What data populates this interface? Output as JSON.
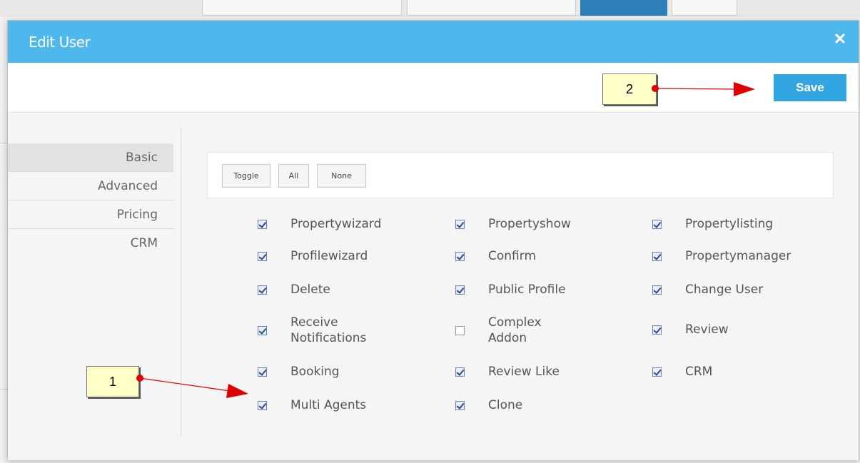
{
  "modal": {
    "title": "Edit User",
    "close_label": "✕",
    "save_label": "Save"
  },
  "sidenav": {
    "items": [
      {
        "label": "Basic",
        "active": true
      },
      {
        "label": "Advanced",
        "active": false
      },
      {
        "label": "Pricing",
        "active": false
      },
      {
        "label": "CRM",
        "active": false
      }
    ]
  },
  "toggle_buttons": {
    "toggle": "Toggle",
    "all": "All",
    "none": "None"
  },
  "permissions": [
    {
      "label": "Propertywizard",
      "checked": true
    },
    {
      "label": "Propertyshow",
      "checked": true
    },
    {
      "label": "Propertylisting",
      "checked": true
    },
    {
      "label": "Profilewizard",
      "checked": true
    },
    {
      "label": "Confirm",
      "checked": true
    },
    {
      "label": "Propertymanager",
      "checked": true
    },
    {
      "label": "Delete",
      "checked": true
    },
    {
      "label": "Public Profile",
      "checked": true
    },
    {
      "label": "Change User",
      "checked": true
    },
    {
      "label": "Receive Notifications",
      "checked": true
    },
    {
      "label": "Complex Addon",
      "checked": false
    },
    {
      "label": "Review",
      "checked": true
    },
    {
      "label": "Booking",
      "checked": true
    },
    {
      "label": "Review Like",
      "checked": true
    },
    {
      "label": "CRM",
      "checked": true
    },
    {
      "label": "Multi Agents",
      "checked": true
    },
    {
      "label": "Clone",
      "checked": true
    }
  ],
  "annotations": [
    {
      "label": "1"
    },
    {
      "label": "2"
    }
  ],
  "colors": {
    "header": "#4eb8ec",
    "save_button": "#33a6e2",
    "annotation_fill": "#ffffc8",
    "arrow": "#e00000"
  }
}
